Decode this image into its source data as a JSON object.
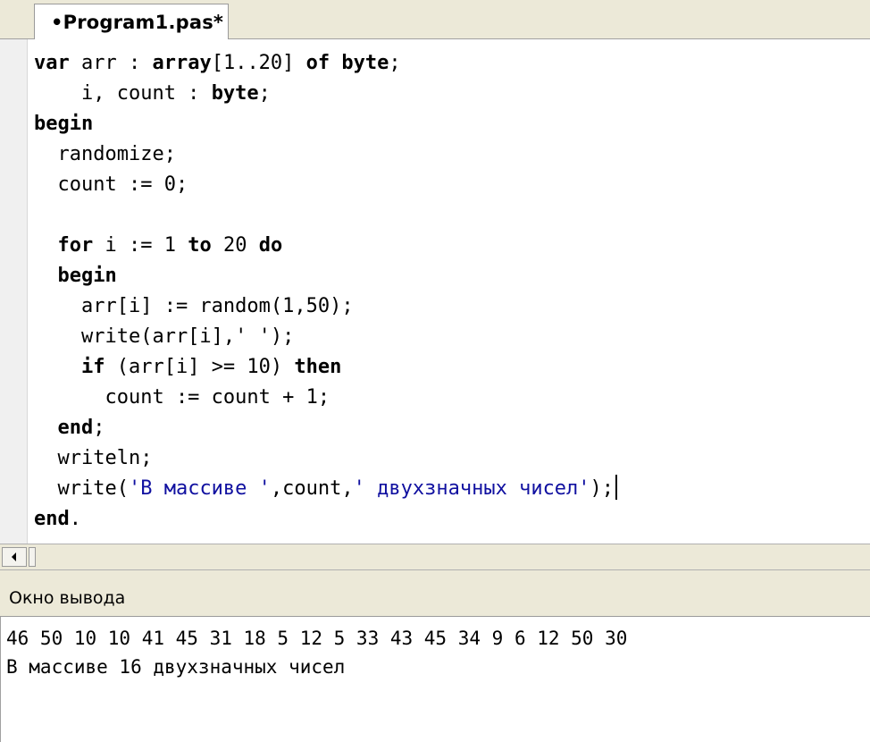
{
  "tab": {
    "title": "•Program1.pas*"
  },
  "editor": {
    "lines": [
      [
        {
          "t": "var",
          "k": "kw"
        },
        {
          "t": " arr : ",
          "k": ""
        },
        {
          "t": "array",
          "k": "kw"
        },
        {
          "t": "[1..20] ",
          "k": ""
        },
        {
          "t": "of",
          "k": "kw"
        },
        {
          "t": " ",
          "k": ""
        },
        {
          "t": "byte",
          "k": "kw"
        },
        {
          "t": ";",
          "k": ""
        }
      ],
      [
        {
          "t": "    i, count : ",
          "k": ""
        },
        {
          "t": "byte",
          "k": "kw"
        },
        {
          "t": ";",
          "k": ""
        }
      ],
      [
        {
          "t": "begin",
          "k": "kw"
        }
      ],
      [
        {
          "t": "  randomize;",
          "k": ""
        }
      ],
      [
        {
          "t": "  count := 0;",
          "k": ""
        }
      ],
      [
        {
          "t": "",
          "k": ""
        }
      ],
      [
        {
          "t": "  ",
          "k": ""
        },
        {
          "t": "for",
          "k": "kw"
        },
        {
          "t": " i := 1 ",
          "k": ""
        },
        {
          "t": "to",
          "k": "kw"
        },
        {
          "t": " 20 ",
          "k": ""
        },
        {
          "t": "do",
          "k": "kw"
        }
      ],
      [
        {
          "t": "  ",
          "k": ""
        },
        {
          "t": "begin",
          "k": "kw"
        }
      ],
      [
        {
          "t": "    arr[i] := random(1,50);",
          "k": ""
        }
      ],
      [
        {
          "t": "    write(arr[i],' ');",
          "k": ""
        }
      ],
      [
        {
          "t": "    ",
          "k": ""
        },
        {
          "t": "if",
          "k": "kw"
        },
        {
          "t": " (arr[i] >= 10) ",
          "k": ""
        },
        {
          "t": "then",
          "k": "kw"
        }
      ],
      [
        {
          "t": "      count := count + 1;",
          "k": ""
        }
      ],
      [
        {
          "t": "  ",
          "k": ""
        },
        {
          "t": "end",
          "k": "kw"
        },
        {
          "t": ";",
          "k": ""
        }
      ],
      [
        {
          "t": "  writeln;",
          "k": ""
        }
      ],
      [
        {
          "t": "  write(",
          "k": ""
        },
        {
          "t": "'В массиве '",
          "k": "str"
        },
        {
          "t": ",count,",
          "k": ""
        },
        {
          "t": "' двухзначных чисел'",
          "k": "str"
        },
        {
          "t": ");",
          "k": ""
        },
        {
          "t": "",
          "k": "caret"
        }
      ],
      [
        {
          "t": "end",
          "k": "kw"
        },
        {
          "t": ".",
          "k": ""
        }
      ]
    ]
  },
  "output": {
    "title": "Окно вывода",
    "lines": [
      "46 50 10 10 41 45 31 18 5 12 5 33 43 45 34 9 6 12 50 30",
      "В массиве 16 двухзначных чисел"
    ]
  },
  "icons": {
    "scroll_left": "arrow-left-icon"
  },
  "colors": {
    "chrome": "#ece9d8",
    "string_literal": "#1010a0"
  }
}
